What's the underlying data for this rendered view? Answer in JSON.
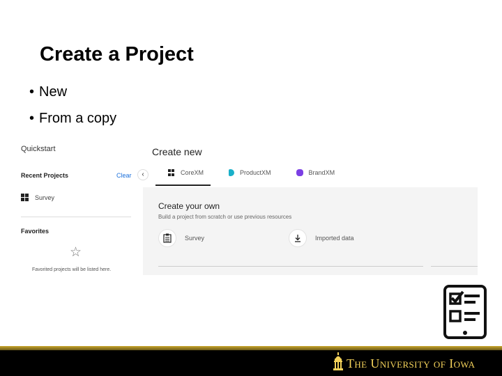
{
  "slide": {
    "title": "Create a Project",
    "bullets": [
      "New",
      "From a copy"
    ]
  },
  "left_panel": {
    "quickstart_label": "Quickstart",
    "recent_projects_label": "Recent Projects",
    "clear_label": "Clear",
    "collapse_icon": "chevron-left-icon",
    "recent_items": [
      "Survey"
    ],
    "favorites_label": "Favorites",
    "favorites_empty_text": "Favorited projects will be listed here."
  },
  "right_panel": {
    "create_new_label": "Create new",
    "tabs": [
      {
        "label": "CoreXM",
        "icon": "grid-icon",
        "color": "#222222",
        "active": true
      },
      {
        "label": "ProductXM",
        "icon": "product-icon",
        "color": "#1ab0c9",
        "active": false
      },
      {
        "label": "BrandXM",
        "icon": "brand-icon",
        "color": "#7b3fe4",
        "active": false
      }
    ],
    "card": {
      "title": "Create your own",
      "subtitle": "Build a project from scratch or use previous resources",
      "options": [
        {
          "label": "Survey",
          "icon": "clipboard-icon"
        },
        {
          "label": "Imported data",
          "icon": "download-icon"
        }
      ]
    }
  },
  "footer": {
    "university_name": "The University of Iowa",
    "accent_color": "#f4d25a"
  }
}
